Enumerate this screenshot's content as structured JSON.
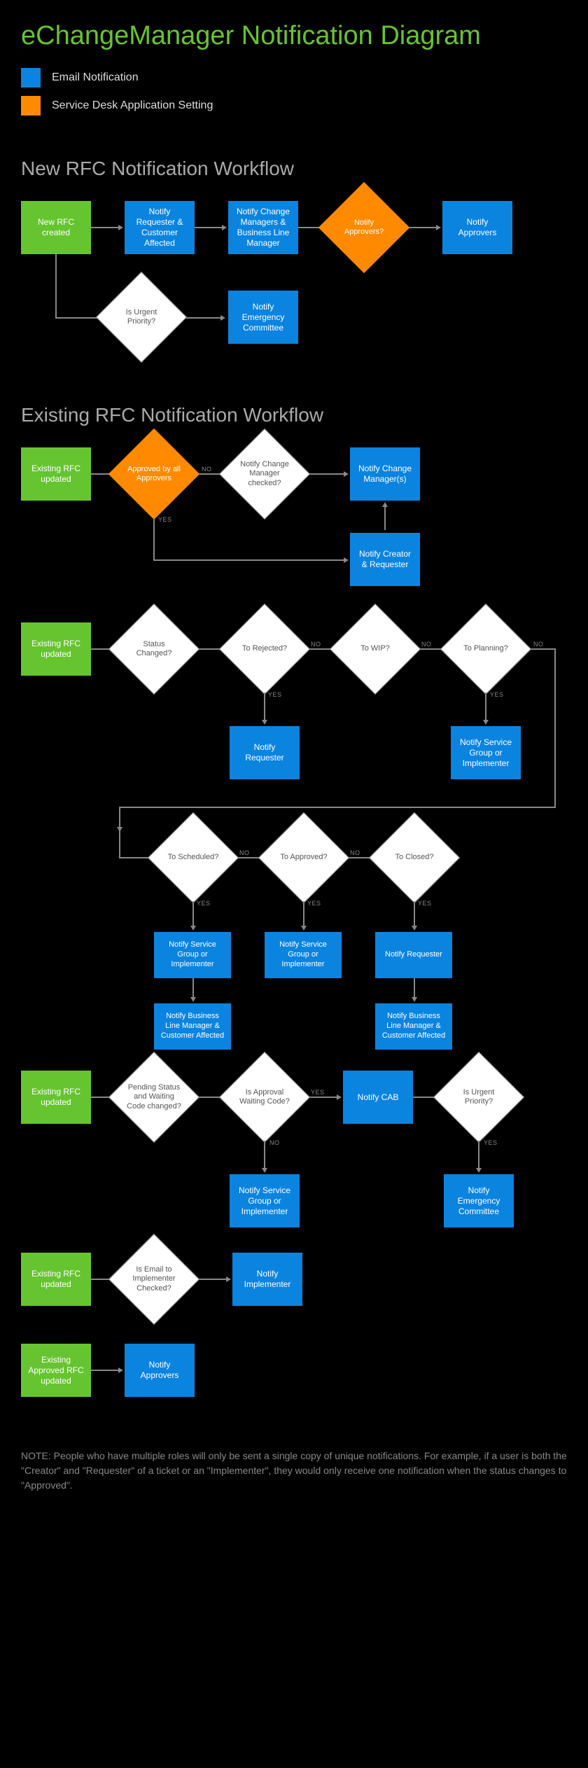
{
  "title": "eChangeManager Notification Diagram",
  "legend": {
    "email": "Email Notification",
    "setting": "Service Desk Application Setting"
  },
  "sections": {
    "new_rfc": "New RFC Notification Workflow",
    "existing_rfc": "Existing RFC Notification Workflow"
  },
  "w1": {
    "start": "New RFC created",
    "b1": "Notify Requester & Customer Affected",
    "b2": "Notify Change Managers & Business Line Manager",
    "d1": "Notify Approvers?",
    "b3": "Notify Approvers",
    "d2": "Is Urgent Priority?",
    "b4": "Notify Emergency Committee"
  },
  "w2": {
    "start": "Existing RFC updated",
    "d1": "Approved by all Approvers",
    "d2": "Notify Change Manager checked?",
    "b1": "Notify Change Manager(s)",
    "b2": "Notify Creator & Requester"
  },
  "w3": {
    "start": "Existing RFC updated",
    "d_status": "Status Changed?",
    "d_rejected": "To Rejected?",
    "d_wip": "To WIP?",
    "d_planning": "To Planning?",
    "d_scheduled": "To Scheduled?",
    "d_approved": "To Approved?",
    "d_closed": "To Closed?",
    "b_req": "Notify Requester",
    "b_sgi": "Notify Service Group or Implementer",
    "b_blm": "Notify Business Line Manager & Customer Affected"
  },
  "w4": {
    "start": "Existing RFC updated",
    "d1": "Pending Status and Waiting Code changed?",
    "d2": "Is Approval Waiting Code?",
    "b_cab": "Notify CAB",
    "d3": "Is Urgent Priority?",
    "b_sgi": "Notify Service Group or Implementer",
    "b_emc": "Notify Emergency Committee"
  },
  "w5": {
    "start": "Existing RFC updated",
    "d1": "Is Email to Implementer Checked?",
    "b1": "Notify Implementer"
  },
  "w6": {
    "start": "Existing Approved RFC updated",
    "b1": "Notify Approvers"
  },
  "labels": {
    "yes": "YES",
    "no": "NO"
  },
  "note": "NOTE: People who have multiple roles will only be sent a single copy of unique notifications. For example, if a user is both the \"Creator\" and \"Requester\" of a ticket or an \"Implementer\", they would only receive one notification when the status changes to \"Approved\"."
}
